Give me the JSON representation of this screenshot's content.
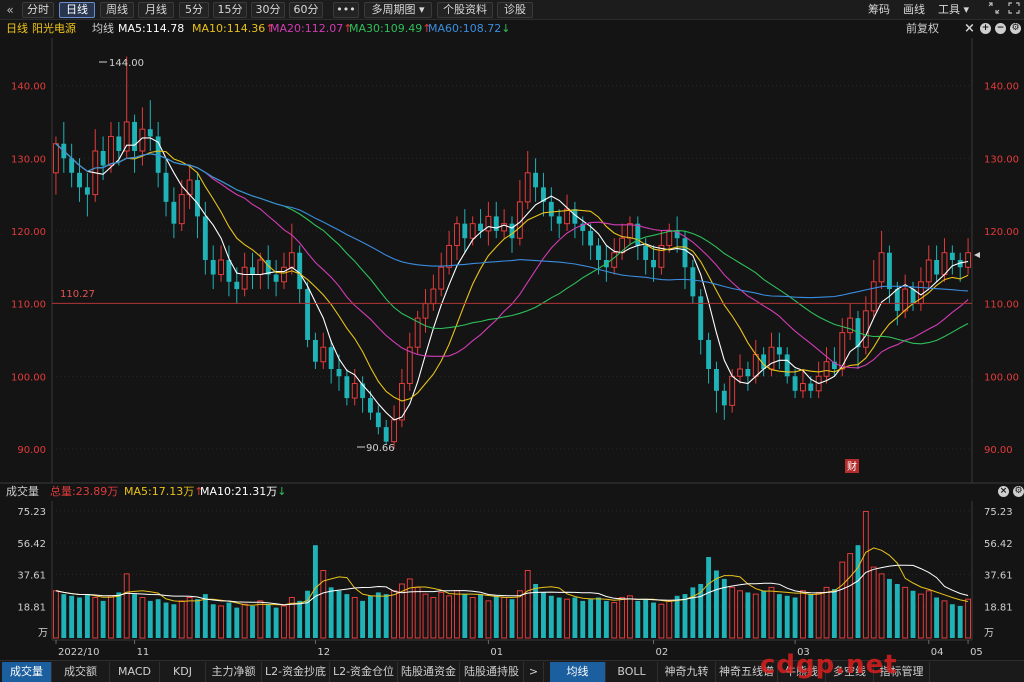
{
  "toolbar": {
    "back_icon": "«",
    "buttons": [
      "分时",
      "日线",
      "周线",
      "月线",
      "5分",
      "15分",
      "30分",
      "60分",
      "•••",
      "多周期图",
      "个股资料",
      "诊股"
    ],
    "right_items": [
      "筹码",
      "画线",
      "工具"
    ],
    "window_icons": [
      "restore-icon",
      "fullscreen-icon"
    ]
  },
  "info": {
    "period": "日线",
    "stock_name": "阳光电源",
    "avg_label": "均线",
    "ma5": "MA5:114.78",
    "ma10": "MA10:114.36",
    "ma20": "MA20:112.07",
    "ma30": "MA30:109.49",
    "ma60": "MA60:108.72",
    "ma60_arrow": "↓",
    "up_arrow": "↑",
    "adjust": "前复权",
    "icons": [
      "close-icon",
      "zoom-in-icon",
      "zoom-out-icon",
      "settings-icon"
    ]
  },
  "price_axis": {
    "ticks": [
      "140.00",
      "130.00",
      "120.00",
      "110.00",
      "100.00",
      "90.00"
    ]
  },
  "price_line": {
    "label": "110.27"
  },
  "annotations": {
    "high": "144.00",
    "low": "90.66",
    "cai": "财"
  },
  "volume": {
    "title": "成交量",
    "total": "总量:23.89万",
    "ma5": "MA5:17.13万",
    "ma10": "MA10:21.31万",
    "ticks": [
      "75.23",
      "56.42",
      "37.61",
      "18.81"
    ],
    "unit": "万"
  },
  "date_axis": [
    "2022/10",
    "11",
    "12",
    "01",
    "02",
    "03",
    "04",
    "05"
  ],
  "tabs": [
    "成交量",
    "成交额",
    "MACD",
    "KDJ",
    "主力净额",
    "L2-资金抄底",
    "L2-资金仓位",
    "陆股通资金",
    "陆股通持股",
    ">",
    "均线",
    "BOLL",
    "神奇九转",
    "神奇五线谱",
    "牛熊线",
    "多空线",
    "指标管理"
  ],
  "watermark": "cdgp.net",
  "colors": {
    "up": "#e23b3b",
    "down": "#1fb3b7",
    "ma5": "#ffffff",
    "ma10": "#e8c21a",
    "ma20": "#d23bb4",
    "ma30": "#2fbf5a",
    "ma60": "#3a8de0"
  },
  "chart_data": {
    "type": "candlestick",
    "y_range": [
      86,
      146
    ],
    "volume_range": [
      0,
      80
    ],
    "candles": [
      [
        128,
        132,
        133,
        125
      ],
      [
        132,
        130,
        135,
        128
      ],
      [
        130,
        128,
        132,
        126
      ],
      [
        128,
        126,
        130,
        124
      ],
      [
        126,
        125,
        128,
        122
      ],
      [
        125,
        131,
        134,
        124
      ],
      [
        131,
        129,
        133,
        127
      ],
      [
        129,
        133,
        135,
        128
      ],
      [
        133,
        131,
        135,
        129
      ],
      [
        131,
        135,
        144,
        130
      ],
      [
        135,
        131,
        136,
        128
      ],
      [
        131,
        134,
        137,
        129
      ],
      [
        134,
        133,
        138,
        131
      ],
      [
        133,
        128,
        135,
        126
      ],
      [
        128,
        124,
        130,
        122
      ],
      [
        124,
        121,
        126,
        119
      ],
      [
        121,
        125,
        127,
        120
      ],
      [
        125,
        127,
        129,
        123
      ],
      [
        127,
        122,
        128,
        119
      ],
      [
        122,
        116,
        124,
        114
      ],
      [
        116,
        114,
        118,
        112
      ],
      [
        114,
        116,
        118,
        113
      ],
      [
        116,
        113,
        118,
        111
      ],
      [
        113,
        112,
        115,
        110
      ],
      [
        112,
        115,
        117,
        111
      ],
      [
        115,
        114,
        117,
        112
      ],
      [
        114,
        116,
        117,
        112
      ],
      [
        116,
        114,
        118,
        112
      ],
      [
        114,
        113,
        116,
        111
      ],
      [
        113,
        115,
        117,
        112
      ],
      [
        115,
        117,
        121,
        114
      ],
      [
        117,
        112,
        118,
        110
      ],
      [
        112,
        105,
        113,
        104
      ],
      [
        105,
        102,
        106,
        101
      ],
      [
        102,
        104,
        106,
        101
      ],
      [
        104,
        101,
        105,
        99
      ],
      [
        101,
        100,
        103,
        98
      ],
      [
        100,
        97,
        101,
        96
      ],
      [
        97,
        99,
        101,
        96
      ],
      [
        99,
        97,
        100,
        95
      ],
      [
        97,
        95,
        98,
        94
      ],
      [
        95,
        93,
        96,
        92
      ],
      [
        93,
        91,
        94,
        90.66
      ],
      [
        91,
        94,
        96,
        90
      ],
      [
        94,
        99,
        101,
        93
      ],
      [
        99,
        104,
        106,
        98
      ],
      [
        104,
        108,
        109,
        103
      ],
      [
        108,
        110,
        112,
        106
      ],
      [
        110,
        112,
        114,
        109
      ],
      [
        112,
        115,
        117,
        111
      ],
      [
        115,
        118,
        120,
        114
      ],
      [
        118,
        121,
        122,
        116
      ],
      [
        121,
        119,
        123,
        117
      ],
      [
        119,
        121,
        122,
        118
      ],
      [
        121,
        120,
        123,
        119
      ],
      [
        120,
        122,
        124,
        118
      ],
      [
        122,
        120,
        124,
        119
      ],
      [
        120,
        121,
        123,
        119
      ],
      [
        121,
        119,
        122,
        117
      ],
      [
        119,
        124,
        127,
        118
      ],
      [
        124,
        128,
        131,
        123
      ],
      [
        128,
        126,
        130,
        124
      ],
      [
        126,
        124,
        128,
        122
      ],
      [
        124,
        122,
        126,
        120
      ],
      [
        122,
        121,
        123,
        119
      ],
      [
        121,
        123,
        125,
        120
      ],
      [
        123,
        121,
        124,
        119
      ],
      [
        121,
        120,
        122,
        118
      ],
      [
        120,
        118,
        121,
        116
      ],
      [
        118,
        116,
        119,
        114
      ],
      [
        116,
        115,
        118,
        113
      ],
      [
        115,
        117,
        119,
        114
      ],
      [
        117,
        119,
        121,
        116
      ],
      [
        119,
        121,
        122,
        118
      ],
      [
        121,
        118,
        122,
        116
      ],
      [
        118,
        116,
        119,
        114
      ],
      [
        116,
        115,
        118,
        113
      ],
      [
        115,
        118,
        120,
        114
      ],
      [
        118,
        120,
        121,
        117
      ],
      [
        120,
        119,
        122,
        117
      ],
      [
        119,
        115,
        120,
        112
      ],
      [
        115,
        111,
        116,
        110
      ],
      [
        111,
        105,
        112,
        103
      ],
      [
        105,
        101,
        106,
        99
      ],
      [
        101,
        98,
        102,
        95
      ],
      [
        98,
        96,
        99,
        94
      ],
      [
        96,
        100,
        101,
        95
      ],
      [
        100,
        101,
        103,
        99
      ],
      [
        101,
        100,
        102,
        98
      ],
      [
        100,
        103,
        105,
        99
      ],
      [
        103,
        101,
        104,
        100
      ],
      [
        101,
        104,
        106,
        100
      ],
      [
        104,
        103,
        106,
        101
      ],
      [
        103,
        100,
        104,
        99
      ],
      [
        100,
        98,
        101,
        97
      ],
      [
        98,
        99,
        101,
        97
      ],
      [
        99,
        98,
        100,
        97
      ],
      [
        98,
        100,
        102,
        97
      ],
      [
        100,
        102,
        104,
        99
      ],
      [
        102,
        101,
        104,
        100
      ],
      [
        101,
        106,
        108,
        100
      ],
      [
        106,
        108,
        110,
        105
      ],
      [
        108,
        104,
        109,
        101
      ],
      [
        104,
        109,
        111,
        103
      ],
      [
        109,
        113,
        116,
        108
      ],
      [
        113,
        117,
        120,
        112
      ],
      [
        117,
        112,
        118,
        110
      ],
      [
        112,
        109,
        113,
        107
      ],
      [
        109,
        112,
        114,
        108
      ],
      [
        112,
        110,
        113,
        109
      ],
      [
        110,
        113,
        115,
        109
      ],
      [
        113,
        116,
        118,
        112
      ],
      [
        116,
        114,
        118,
        113
      ],
      [
        114,
        117,
        119,
        113
      ],
      [
        117,
        116,
        118,
        114
      ],
      [
        116,
        115,
        117,
        113
      ],
      [
        115,
        117,
        119,
        114
      ]
    ],
    "volumes": [
      28,
      26,
      25,
      24,
      26,
      24,
      22,
      25,
      27,
      38,
      26,
      24,
      22,
      23,
      21,
      20,
      22,
      24,
      23,
      26,
      20,
      19,
      21,
      18,
      20,
      19,
      22,
      20,
      18,
      19,
      24,
      22,
      28,
      55,
      40,
      30,
      28,
      26,
      24,
      22,
      25,
      27,
      26,
      28,
      32,
      35,
      30,
      26,
      24,
      27,
      25,
      28,
      26,
      24,
      26,
      22,
      25,
      24,
      23,
      28,
      40,
      32,
      27,
      25,
      24,
      23,
      24,
      22,
      23,
      24,
      22,
      21,
      24,
      25,
      22,
      23,
      21,
      20,
      22,
      25,
      26,
      30,
      32,
      48,
      40,
      35,
      30,
      28,
      27,
      26,
      28,
      30,
      26,
      25,
      24,
      28,
      26,
      27,
      30,
      29,
      45,
      50,
      55,
      75,
      42,
      38,
      35,
      32,
      30,
      28,
      26,
      28,
      24,
      22,
      20,
      19,
      23
    ]
  }
}
